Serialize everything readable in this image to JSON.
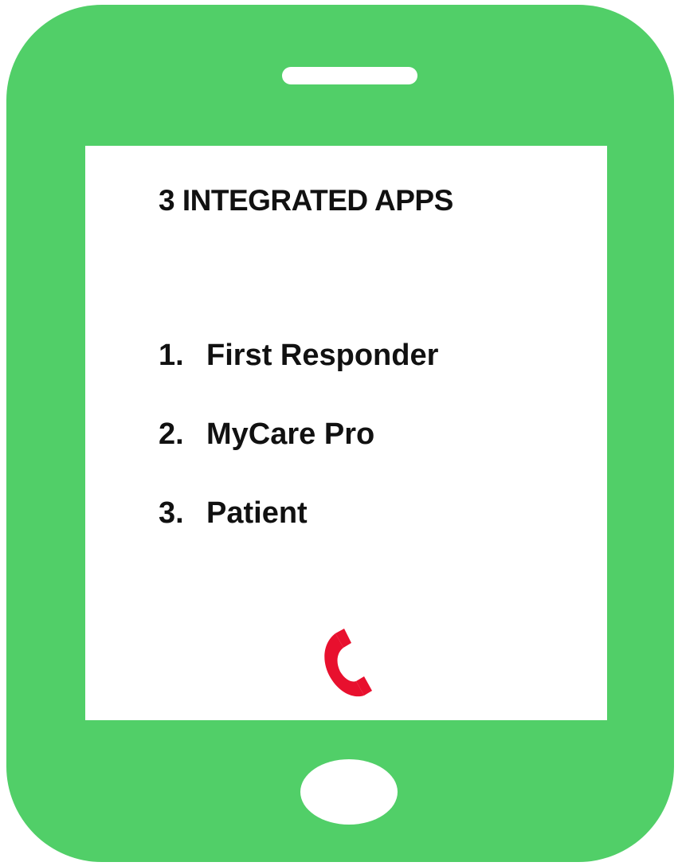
{
  "screen": {
    "title": "3 INTEGRATED APPS",
    "apps": [
      {
        "number": "1.",
        "name": "First Responder"
      },
      {
        "number": "2.",
        "name": "MyCare Pro"
      },
      {
        "number": "3.",
        "name": "Patient"
      }
    ],
    "call_icon": "phone-handset-icon"
  },
  "colors": {
    "phone_body": "#51cf68",
    "screen": "#ffffff",
    "text": "#111111",
    "call_icon": "#e8102e"
  }
}
